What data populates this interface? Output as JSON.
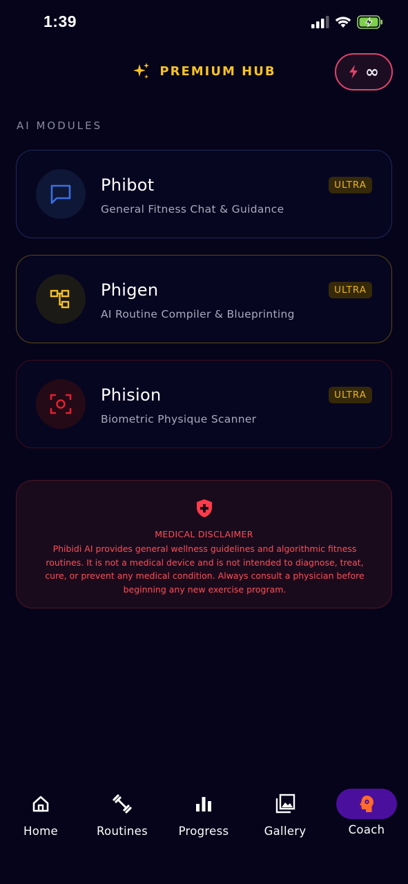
{
  "status_bar": {
    "time": "1:39"
  },
  "header": {
    "title": "PREMIUM HUB",
    "energy_value": "∞"
  },
  "section_label": "AI MODULES",
  "modules": [
    {
      "name": "Phibot",
      "description": "General Fitness Chat & Guidance",
      "badge": "ULTRA",
      "icon": "chat-icon",
      "accent": "#3b6fe0"
    },
    {
      "name": "Phigen",
      "description": "AI Routine Compiler & Blueprinting",
      "badge": "ULTRA",
      "icon": "flowchart-icon",
      "accent": "#f5c227"
    },
    {
      "name": "Phision",
      "description": "Biometric Physique Scanner",
      "badge": "ULTRA",
      "icon": "scan-icon",
      "accent": "#e02030"
    }
  ],
  "disclaimer": {
    "title": "MEDICAL DISCLAIMER",
    "body": "Phibidi AI provides general wellness guidelines and algorithmic fitness routines. It is not a medical device and is not intended to diagnose, treat, cure, or prevent any medical condition. Always consult a physician before beginning any new exercise program."
  },
  "nav": [
    {
      "label": "Home",
      "icon": "home-icon"
    },
    {
      "label": "Routines",
      "icon": "dumbbell-icon"
    },
    {
      "label": "Progress",
      "icon": "bar-chart-icon"
    },
    {
      "label": "Gallery",
      "icon": "gallery-icon"
    },
    {
      "label": "Coach",
      "icon": "brain-icon",
      "active": true
    }
  ],
  "colors": {
    "background": "#06041a",
    "gold": "#f5c227",
    "pink": "#e0446a",
    "red_text": "#ff4d57",
    "active_nav": "#4b0f9e",
    "nav_active_icon": "#ff6b2a"
  }
}
